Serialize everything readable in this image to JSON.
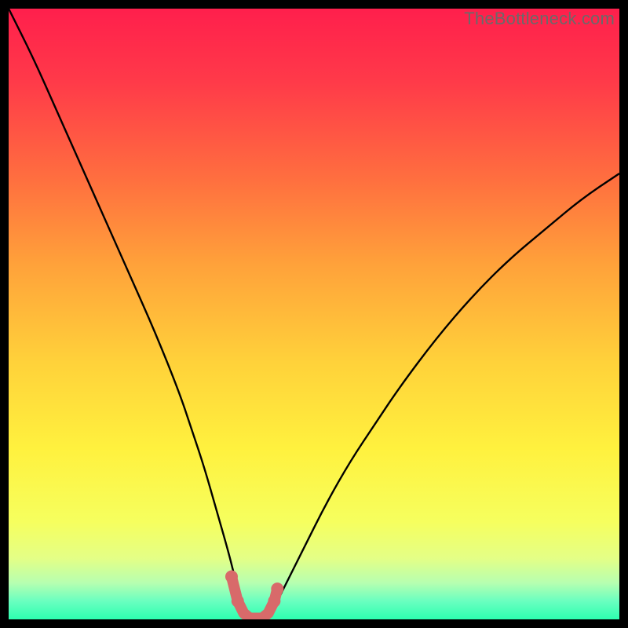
{
  "watermark": "TheBottleneck.com",
  "chart_data": {
    "type": "line",
    "title": "",
    "xlabel": "",
    "ylabel": "",
    "xlim": [
      0,
      100
    ],
    "ylim": [
      0,
      100
    ],
    "grid": false,
    "legend": false,
    "series": [
      {
        "name": "bottleneck-curve",
        "x": [
          0,
          4,
          8,
          12,
          16,
          20,
          24,
          28,
          30,
          32,
          34,
          36,
          37,
          38,
          39,
          40,
          41,
          42,
          43,
          44,
          46,
          48,
          52,
          56,
          60,
          64,
          70,
          76,
          82,
          88,
          94,
          100
        ],
        "y": [
          100,
          92,
          83,
          74,
          65,
          56,
          47,
          37,
          31,
          25,
          18,
          11,
          7,
          3,
          1,
          0,
          0,
          0,
          1,
          3,
          7,
          11,
          19,
          26,
          32,
          38,
          46,
          53,
          59,
          64,
          69,
          73
        ]
      },
      {
        "name": "highlight-trough",
        "x": [
          36.5,
          37.5,
          38.5,
          39.5,
          40.5,
          41.5,
          42.5,
          43.5,
          44.0
        ],
        "y": [
          7.0,
          3.0,
          1.0,
          0.2,
          0.2,
          0.2,
          1.0,
          3.0,
          5.0
        ]
      }
    ],
    "background_gradient": {
      "stops": [
        {
          "offset": 0.0,
          "color": "#ff1f4c"
        },
        {
          "offset": 0.12,
          "color": "#ff3a49"
        },
        {
          "offset": 0.28,
          "color": "#ff6f3f"
        },
        {
          "offset": 0.42,
          "color": "#ffa23a"
        },
        {
          "offset": 0.58,
          "color": "#ffd23a"
        },
        {
          "offset": 0.72,
          "color": "#fff13e"
        },
        {
          "offset": 0.84,
          "color": "#f6ff5e"
        },
        {
          "offset": 0.9,
          "color": "#e4ff86"
        },
        {
          "offset": 0.94,
          "color": "#b7ffb0"
        },
        {
          "offset": 0.97,
          "color": "#6affc0"
        },
        {
          "offset": 1.0,
          "color": "#2dffb0"
        }
      ]
    },
    "colors": {
      "curve": "#000000",
      "highlight": "#d86a6a"
    }
  }
}
